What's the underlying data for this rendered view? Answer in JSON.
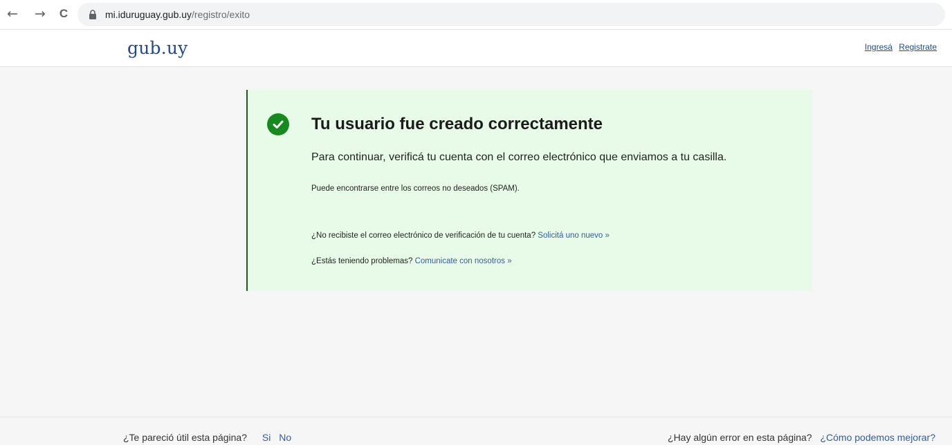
{
  "browser": {
    "url_host": "mi.iduruguay.gub.uy",
    "url_path": "/registro/exito",
    "back_icon": "←",
    "forward_icon": "→",
    "reload_icon": "C"
  },
  "header": {
    "logo": "gub.uy",
    "login_link": "Ingresá",
    "register_link": "Registrate"
  },
  "card": {
    "title": "Tu usuario fue creado correctamente",
    "lead": "Para continuar, verificá tu cuenta con el correo electrónico que enviamos a tu casilla.",
    "spam_note": "Puede encontrarse entre los correos no deseados (SPAM).",
    "resend_question": "¿No recibiste el correo electrónico de verificación de tu cuenta?",
    "resend_link": "Solicitá uno nuevo »",
    "problems_question": "¿Estás teniendo problemas?",
    "contact_link": "Comunicate con nosotros »"
  },
  "footer": {
    "useful_question": "¿Te pareció útil esta página?",
    "yes_link": "Si",
    "no_link": "No",
    "error_question": "¿Hay algún error en esta página?",
    "improve_link": "¿Cómo podemos mejorar?"
  },
  "colors": {
    "brand_blue": "#1f4a8e",
    "success_green": "#168a1e",
    "card_background": "#e8fbe8"
  }
}
